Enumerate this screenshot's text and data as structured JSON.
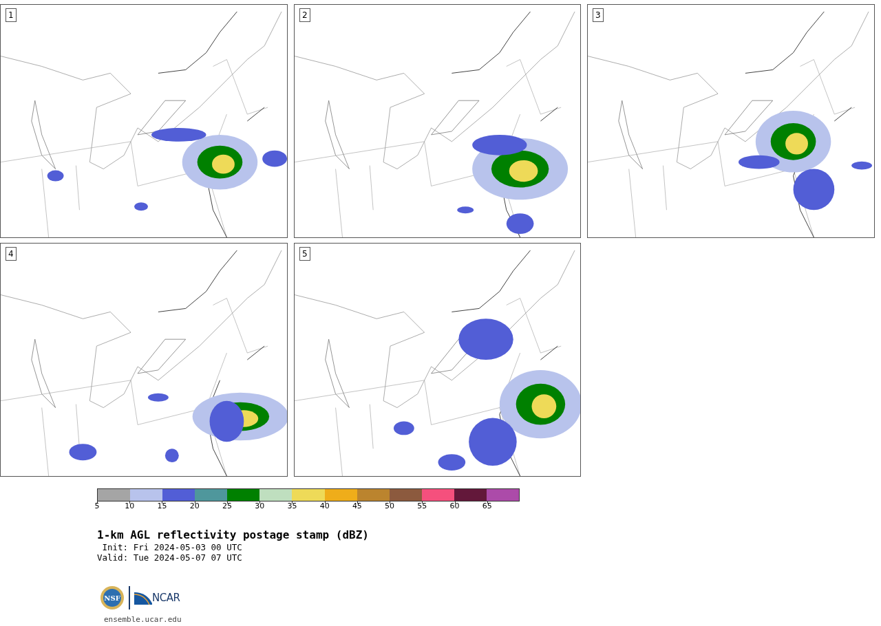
{
  "panels": [
    {
      "label": "1"
    },
    {
      "label": "2"
    },
    {
      "label": "3"
    },
    {
      "label": "4"
    },
    {
      "label": "5"
    }
  ],
  "colorbar": {
    "segments": [
      {
        "color": "#a5a5a5"
      },
      {
        "color": "#b8c3ec"
      },
      {
        "color": "#525ed6"
      },
      {
        "color": "#4f979c"
      },
      {
        "color": "#008000"
      },
      {
        "color": "#bfdfbf"
      },
      {
        "color": "#eeda58"
      },
      {
        "color": "#efad1a"
      },
      {
        "color": "#bb842e"
      },
      {
        "color": "#8c5a3e"
      },
      {
        "color": "#f5507d"
      },
      {
        "color": "#63183a"
      },
      {
        "color": "#ac4ba9"
      }
    ],
    "ticks": [
      "5",
      "10",
      "15",
      "20",
      "25",
      "30",
      "35",
      "40",
      "45",
      "50",
      "55",
      "60",
      "65"
    ]
  },
  "title": "1-km AGL reflectivity postage stamp (dBZ)",
  "init": "Init: Fri 2024-05-03 00 UTC",
  "valid": "Valid: Tue 2024-05-07 07 UTC",
  "logo": {
    "emblem_text": "NSF",
    "wordmark": "NCAR"
  },
  "url": "ensemble.ucar.edu"
}
